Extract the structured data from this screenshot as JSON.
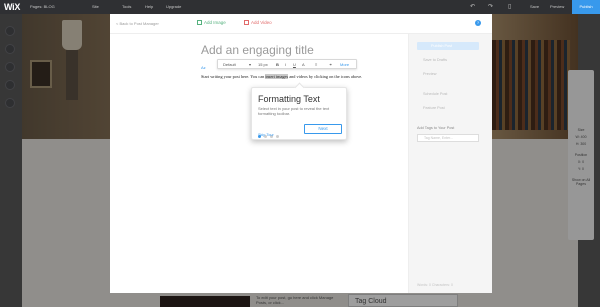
{
  "topbar": {
    "logo": "WiX",
    "pages": "Pages: BLOG",
    "menu": [
      "Site",
      "Tools",
      "Help",
      "Upgrade"
    ],
    "save": "Save",
    "preview": "Preview",
    "publish": "Publish",
    "undo_icon": "undo-icon",
    "redo_icon": "redo-icon",
    "mobile_icon": "mobile-icon"
  },
  "modal": {
    "back": "< Back to Post Manager",
    "add_image": "Add Image",
    "add_video": "Add Video",
    "title_placeholder": "Add an engaging title",
    "az_link": "Az",
    "body_before": "Start writing your post here. You can ",
    "body_highlight": "insert images",
    "body_after": " and videos by clicking on the icons above."
  },
  "toolbar": {
    "style": "Default",
    "size": "15 px",
    "bold": "B",
    "italic": "I",
    "underline": "U",
    "color": "A",
    "align": "≡",
    "link": "🔗",
    "more": "More"
  },
  "tooltip": {
    "heading": "Formatting Text",
    "body": "Select text in your post to reveal the text formatting toolbar.",
    "next": "Next",
    "skip": "Skip Tour",
    "steps_total": 4,
    "current_step": 1
  },
  "sidebar": {
    "publish": "Publish Post",
    "items": [
      "Save to Drafts",
      "Preview",
      "Schedule Post",
      "Feature Post"
    ],
    "tags_heading": "Add Tags to Your Post",
    "tag_placeholder": "Tag Name, Enter...",
    "footer": "Words: 0    Characters: 0"
  },
  "background": {
    "tag_cloud": "Tag Cloud",
    "lower_text": "To edit your post, go here and click Manage Posts, or click..."
  },
  "rightpanel": {
    "labels": [
      "Size",
      "W: 400",
      "H: 300",
      "Position",
      "X: 0",
      "Y: 0",
      "Show on All Pages"
    ]
  }
}
